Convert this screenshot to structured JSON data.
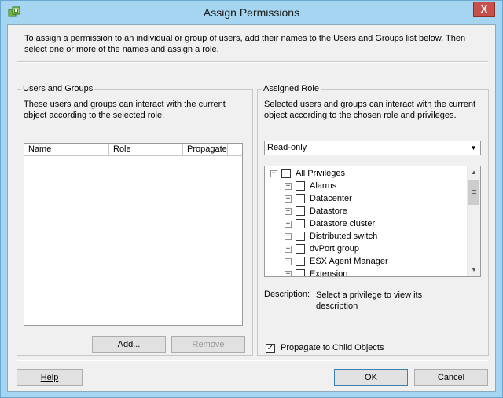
{
  "window": {
    "title": "Assign Permissions",
    "close_glyph": "X"
  },
  "intro_text": "To assign a permission to an individual or group of users, add their names to the Users and Groups list below. Then select one or more of the names and assign a role.",
  "users_groups": {
    "title": "Users and Groups",
    "description": "These users and groups can interact with the current object according to the selected role.",
    "columns": [
      "Name",
      "Role",
      "Propagate"
    ],
    "add_label": "Add...",
    "remove_label": "Remove"
  },
  "assigned_role": {
    "title": "Assigned Role",
    "description": "Selected users and groups can interact with the current object according to the chosen role and privileges.",
    "role_selected": "Read-only",
    "privileges": {
      "root": "All Privileges",
      "items": [
        "Alarms",
        "Datacenter",
        "Datastore",
        "Datastore cluster",
        "Distributed switch",
        "dvPort group",
        "ESX Agent Manager",
        "Extension"
      ]
    },
    "description_label": "Description:",
    "description_text": "Select a privilege to view its description",
    "propagate_label": "Propagate to Child Objects",
    "propagate_checked": true
  },
  "buttons": {
    "help": "Help",
    "ok": "OK",
    "cancel": "Cancel"
  }
}
